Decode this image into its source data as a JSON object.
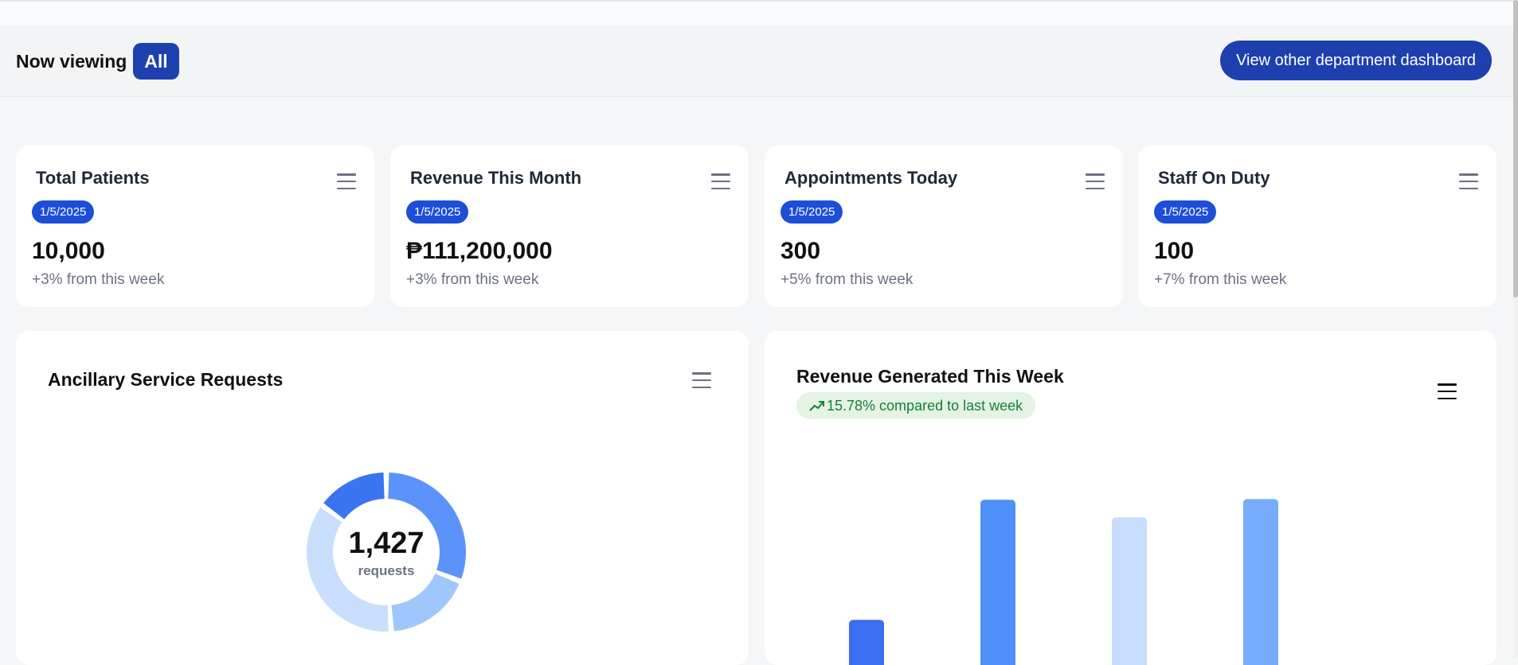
{
  "header": {
    "now_viewing_label": "Now viewing",
    "current_view": "All",
    "department_button": "View other department dashboard"
  },
  "stats": [
    {
      "title": "Total Patients",
      "date": "1/5/2025",
      "value": "10,000",
      "change": "+3% from this week"
    },
    {
      "title": "Revenue This Month",
      "date": "1/5/2025",
      "value": "₱111,200,000",
      "change": "+3% from this week"
    },
    {
      "title": "Appointments Today",
      "date": "1/5/2025",
      "value": "300",
      "change": "+5% from this week"
    },
    {
      "title": "Staff On Duty",
      "date": "1/5/2025",
      "value": "100",
      "change": "+7% from this week"
    }
  ],
  "ancillary": {
    "title": "Ancillary Service Requests",
    "total": "1,427",
    "total_label": "requests"
  },
  "revenue_week": {
    "title": "Revenue Generated This Week",
    "trend_text": "15.78% compared to last week"
  },
  "colors": {
    "primary": "#1e40af",
    "badge": "#1d4ed8",
    "trend_bg": "#e4f3e4",
    "trend_text": "#15803d"
  },
  "chart_data": [
    {
      "type": "pie",
      "title": "Ancillary Service Requests",
      "total": 1427,
      "slices": [
        {
          "value": 0.31,
          "color": "#5b93fb"
        },
        {
          "value": 0.18,
          "color": "#9fc7fc"
        },
        {
          "value": 0.36,
          "color": "#c9defd"
        },
        {
          "value": 0.15,
          "color": "#3b74f0"
        }
      ]
    },
    {
      "type": "bar",
      "title": "Revenue Generated This Week",
      "values": [
        59,
        216,
        193,
        217
      ],
      "colors": [
        "#3b6ff0",
        "#4f8ff8",
        "#c8dcfd",
        "#76acfb"
      ],
      "ylim": [
        0,
        260
      ]
    }
  ]
}
